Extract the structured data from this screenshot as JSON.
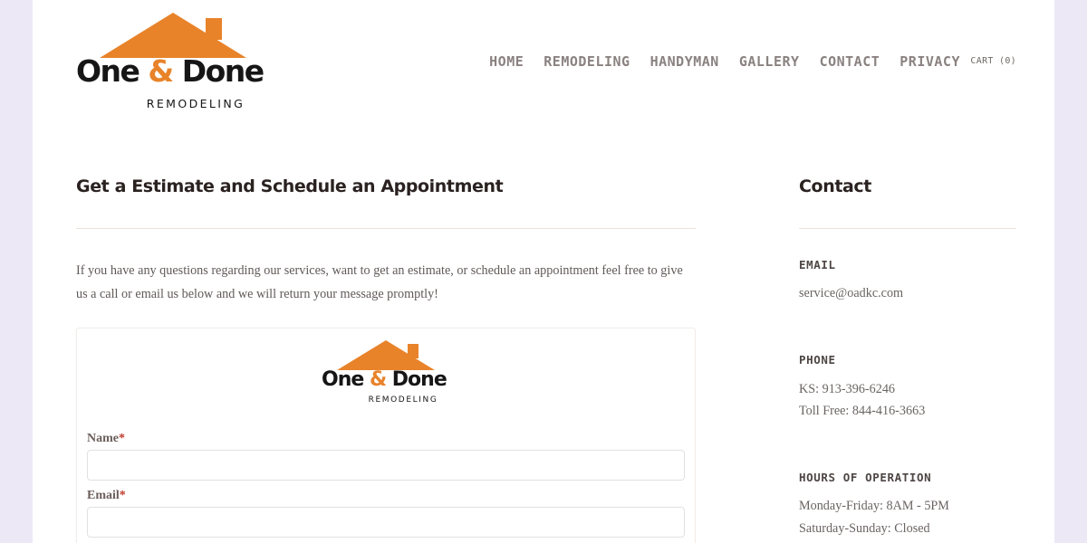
{
  "brand": {
    "logo_word_part1": "One ",
    "logo_amp": "&",
    "logo_word_part2": " Done",
    "logo_sub": "REMODELING",
    "roof_color": "#e8832a",
    "text_color": "#161616"
  },
  "nav": {
    "items": [
      {
        "label": "HOME"
      },
      {
        "label": "REMODELING"
      },
      {
        "label": "HANDYMAN"
      },
      {
        "label": "GALLERY"
      },
      {
        "label": "CONTACT"
      },
      {
        "label": "PRIVACY"
      }
    ],
    "cart_label": "CART (0)"
  },
  "main": {
    "title": "Get a Estimate and Schedule an Appointment",
    "intro": "If you have any questions regarding our services, want to get an estimate, or schedule an appointment feel free to give us a call or email us below and we will return your message promptly!",
    "form": {
      "fields": [
        {
          "label": "Name",
          "required_mark": "*",
          "value": "",
          "placeholder": ""
        },
        {
          "label": "Email",
          "required_mark": "*",
          "value": "",
          "placeholder": ""
        }
      ]
    }
  },
  "sidebar": {
    "title": "Contact",
    "email_heading": "EMAIL",
    "email": "service@oadkc.com",
    "phone_heading": "PHONE",
    "phone_ks": "KS: 913-396-6246",
    "phone_toll": "Toll Free: 844-416-3663",
    "hours_heading": "HOURS OF OPERATION",
    "hours_weekday": "Monday-Friday: 8AM - 5PM",
    "hours_weekend": "Saturday-Sunday: Closed"
  }
}
